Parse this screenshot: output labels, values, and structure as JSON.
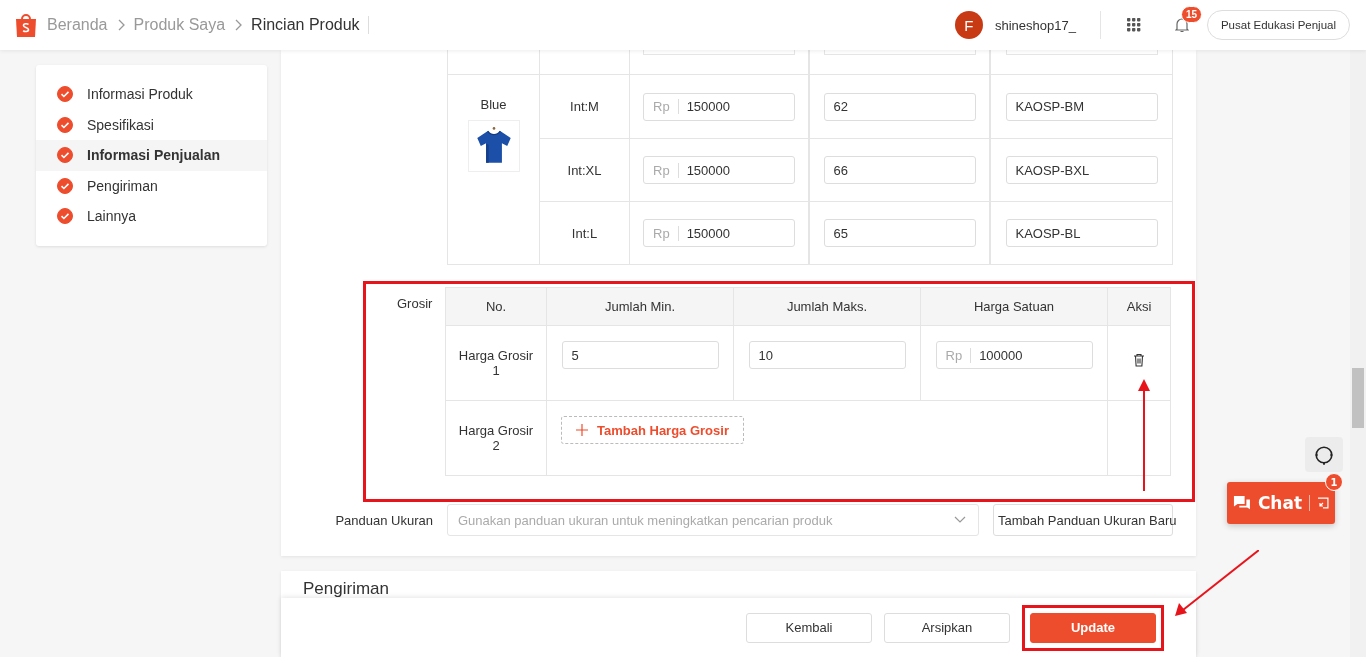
{
  "breadcrumb": [
    {
      "label": "Beranda",
      "current": false
    },
    {
      "label": "Produk Saya",
      "current": false
    },
    {
      "label": "Rincian Produk",
      "current": true
    }
  ],
  "user": {
    "initial": "F",
    "name": "shineshop17_"
  },
  "notifications": {
    "count": "15"
  },
  "edu_button": "Pusat Edukasi Penjual",
  "sidebar": {
    "items": [
      {
        "label": "Informasi Produk",
        "done": true,
        "selected": false
      },
      {
        "label": "Spesifikasi",
        "done": true,
        "selected": false
      },
      {
        "label": "Informasi Penjualan",
        "done": true,
        "selected": true
      },
      {
        "label": "Pengiriman",
        "done": true,
        "selected": false
      },
      {
        "label": "Lainnya",
        "done": true,
        "selected": false
      }
    ]
  },
  "variations": {
    "groups": [
      {
        "name": "Blue",
        "rows": [
          {
            "size": "Int:M",
            "currency": "Rp",
            "price": "150000",
            "stock": "62",
            "sku": "KAOSP-BM"
          },
          {
            "size": "Int:XL",
            "currency": "Rp",
            "price": "150000",
            "stock": "66",
            "sku": "KAOSP-BXL"
          },
          {
            "size": "Int:L",
            "currency": "Rp",
            "price": "150000",
            "stock": "65",
            "sku": "KAOSP-BL"
          }
        ]
      }
    ]
  },
  "wholesale": {
    "label": "Grosir",
    "columns": [
      "No.",
      "Jumlah Min.",
      "Jumlah Maks.",
      "Harga Satuan",
      "Aksi"
    ],
    "tiers": [
      {
        "name": "Harga Grosir 1",
        "min": "5",
        "max": "10",
        "currency": "Rp",
        "price": "100000"
      }
    ],
    "next_tier": {
      "name": "Harga Grosir 2",
      "add_button": "Tambah Harga Grosir"
    }
  },
  "size_guide": {
    "label": "Panduan Ukuran",
    "placeholder": "Gunakan panduan ukuran untuk meningkatkan pencarian produk",
    "add_button": "Tambah Panduan Ukuran Baru"
  },
  "shipping_section": {
    "title": "Pengiriman"
  },
  "footer_buttons": [
    {
      "label": "Kembali",
      "kind": "secondary"
    },
    {
      "label": "Arsipkan",
      "kind": "secondary"
    },
    {
      "label": "Update",
      "kind": "primary"
    }
  ],
  "chat": {
    "label": "Chat",
    "badge": "1"
  }
}
